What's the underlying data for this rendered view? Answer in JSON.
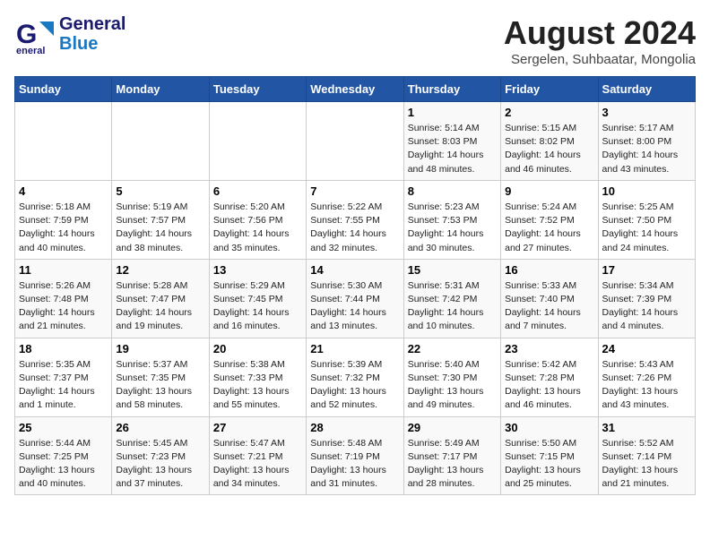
{
  "header": {
    "logo_line1": "General",
    "logo_line2": "Blue",
    "month_title": "August 2024",
    "subtitle": "Sergelen, Suhbaatar, Mongolia"
  },
  "weekdays": [
    "Sunday",
    "Monday",
    "Tuesday",
    "Wednesday",
    "Thursday",
    "Friday",
    "Saturday"
  ],
  "weeks": [
    [
      {
        "day": "",
        "info": ""
      },
      {
        "day": "",
        "info": ""
      },
      {
        "day": "",
        "info": ""
      },
      {
        "day": "",
        "info": ""
      },
      {
        "day": "1",
        "info": "Sunrise: 5:14 AM\nSunset: 8:03 PM\nDaylight: 14 hours and 48 minutes."
      },
      {
        "day": "2",
        "info": "Sunrise: 5:15 AM\nSunset: 8:02 PM\nDaylight: 14 hours and 46 minutes."
      },
      {
        "day": "3",
        "info": "Sunrise: 5:17 AM\nSunset: 8:00 PM\nDaylight: 14 hours and 43 minutes."
      }
    ],
    [
      {
        "day": "4",
        "info": "Sunrise: 5:18 AM\nSunset: 7:59 PM\nDaylight: 14 hours and 40 minutes."
      },
      {
        "day": "5",
        "info": "Sunrise: 5:19 AM\nSunset: 7:57 PM\nDaylight: 14 hours and 38 minutes."
      },
      {
        "day": "6",
        "info": "Sunrise: 5:20 AM\nSunset: 7:56 PM\nDaylight: 14 hours and 35 minutes."
      },
      {
        "day": "7",
        "info": "Sunrise: 5:22 AM\nSunset: 7:55 PM\nDaylight: 14 hours and 32 minutes."
      },
      {
        "day": "8",
        "info": "Sunrise: 5:23 AM\nSunset: 7:53 PM\nDaylight: 14 hours and 30 minutes."
      },
      {
        "day": "9",
        "info": "Sunrise: 5:24 AM\nSunset: 7:52 PM\nDaylight: 14 hours and 27 minutes."
      },
      {
        "day": "10",
        "info": "Sunrise: 5:25 AM\nSunset: 7:50 PM\nDaylight: 14 hours and 24 minutes."
      }
    ],
    [
      {
        "day": "11",
        "info": "Sunrise: 5:26 AM\nSunset: 7:48 PM\nDaylight: 14 hours and 21 minutes."
      },
      {
        "day": "12",
        "info": "Sunrise: 5:28 AM\nSunset: 7:47 PM\nDaylight: 14 hours and 19 minutes."
      },
      {
        "day": "13",
        "info": "Sunrise: 5:29 AM\nSunset: 7:45 PM\nDaylight: 14 hours and 16 minutes."
      },
      {
        "day": "14",
        "info": "Sunrise: 5:30 AM\nSunset: 7:44 PM\nDaylight: 14 hours and 13 minutes."
      },
      {
        "day": "15",
        "info": "Sunrise: 5:31 AM\nSunset: 7:42 PM\nDaylight: 14 hours and 10 minutes."
      },
      {
        "day": "16",
        "info": "Sunrise: 5:33 AM\nSunset: 7:40 PM\nDaylight: 14 hours and 7 minutes."
      },
      {
        "day": "17",
        "info": "Sunrise: 5:34 AM\nSunset: 7:39 PM\nDaylight: 14 hours and 4 minutes."
      }
    ],
    [
      {
        "day": "18",
        "info": "Sunrise: 5:35 AM\nSunset: 7:37 PM\nDaylight: 14 hours and 1 minute."
      },
      {
        "day": "19",
        "info": "Sunrise: 5:37 AM\nSunset: 7:35 PM\nDaylight: 13 hours and 58 minutes."
      },
      {
        "day": "20",
        "info": "Sunrise: 5:38 AM\nSunset: 7:33 PM\nDaylight: 13 hours and 55 minutes."
      },
      {
        "day": "21",
        "info": "Sunrise: 5:39 AM\nSunset: 7:32 PM\nDaylight: 13 hours and 52 minutes."
      },
      {
        "day": "22",
        "info": "Sunrise: 5:40 AM\nSunset: 7:30 PM\nDaylight: 13 hours and 49 minutes."
      },
      {
        "day": "23",
        "info": "Sunrise: 5:42 AM\nSunset: 7:28 PM\nDaylight: 13 hours and 46 minutes."
      },
      {
        "day": "24",
        "info": "Sunrise: 5:43 AM\nSunset: 7:26 PM\nDaylight: 13 hours and 43 minutes."
      }
    ],
    [
      {
        "day": "25",
        "info": "Sunrise: 5:44 AM\nSunset: 7:25 PM\nDaylight: 13 hours and 40 minutes."
      },
      {
        "day": "26",
        "info": "Sunrise: 5:45 AM\nSunset: 7:23 PM\nDaylight: 13 hours and 37 minutes."
      },
      {
        "day": "27",
        "info": "Sunrise: 5:47 AM\nSunset: 7:21 PM\nDaylight: 13 hours and 34 minutes."
      },
      {
        "day": "28",
        "info": "Sunrise: 5:48 AM\nSunset: 7:19 PM\nDaylight: 13 hours and 31 minutes."
      },
      {
        "day": "29",
        "info": "Sunrise: 5:49 AM\nSunset: 7:17 PM\nDaylight: 13 hours and 28 minutes."
      },
      {
        "day": "30",
        "info": "Sunrise: 5:50 AM\nSunset: 7:15 PM\nDaylight: 13 hours and 25 minutes."
      },
      {
        "day": "31",
        "info": "Sunrise: 5:52 AM\nSunset: 7:14 PM\nDaylight: 13 hours and 21 minutes."
      }
    ]
  ]
}
